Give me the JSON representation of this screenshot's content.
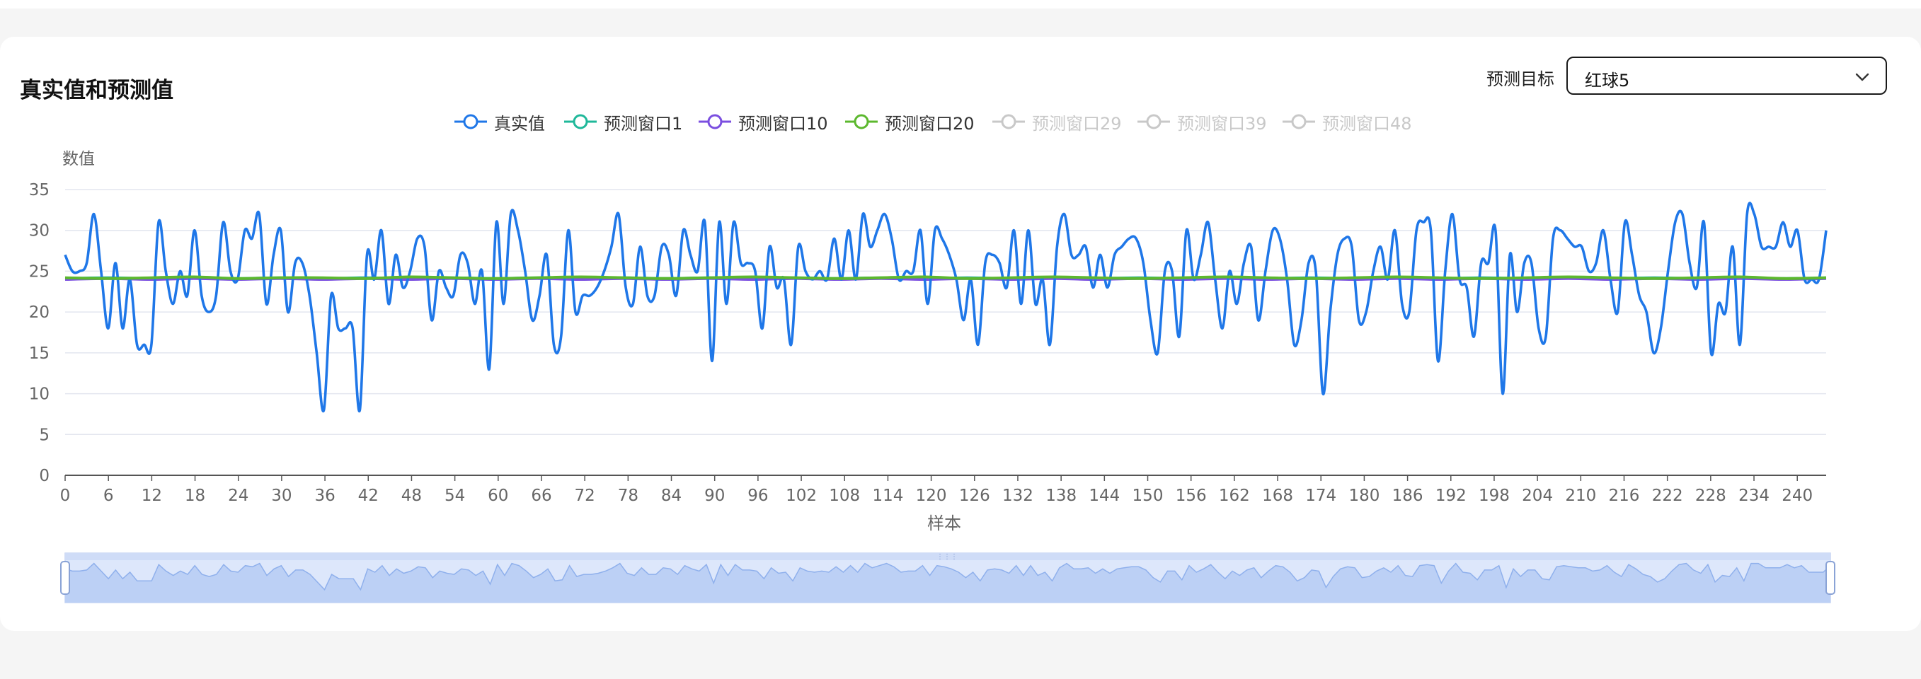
{
  "card": {
    "title": "真实值和预测值"
  },
  "target": {
    "label": "预测目标",
    "value": "红球5"
  },
  "legend": [
    {
      "name": "真实值",
      "color": "#1f77e8",
      "active": true
    },
    {
      "name": "预测窗口1",
      "color": "#1fb89a",
      "active": true
    },
    {
      "name": "预测窗口10",
      "color": "#7b4fe0",
      "active": true
    },
    {
      "name": "预测窗口20",
      "color": "#5cb82e",
      "active": true
    },
    {
      "name": "预测窗口29",
      "color": "#c8c8c8",
      "active": false
    },
    {
      "name": "预测窗口39",
      "color": "#c8c8c8",
      "active": false
    },
    {
      "name": "预测窗口48",
      "color": "#c8c8c8",
      "active": false
    }
  ],
  "chart_data": {
    "type": "line",
    "title": "",
    "xlabel": "样本",
    "ylabel": "数值",
    "ylim": [
      0,
      35
    ],
    "yticks": [
      0,
      5,
      10,
      15,
      20,
      25,
      30,
      35
    ],
    "xlim": [
      0,
      244
    ],
    "xticks": [
      0,
      6,
      12,
      18,
      24,
      30,
      36,
      42,
      48,
      54,
      60,
      66,
      72,
      78,
      84,
      90,
      96,
      102,
      108,
      114,
      120,
      126,
      132,
      138,
      144,
      150,
      156,
      162,
      168,
      174,
      180,
      186,
      192,
      198,
      204,
      210,
      216,
      222,
      228,
      234,
      240
    ],
    "grid": true,
    "legend_position": "top-center",
    "series": [
      {
        "name": "真实值",
        "color": "#1f77e8",
        "values": [
          27,
          25,
          25,
          26,
          32,
          25,
          18,
          26,
          18,
          24,
          16,
          16,
          16,
          31,
          25,
          21,
          25,
          22,
          30,
          22,
          20,
          22,
          31,
          25,
          24,
          30,
          29,
          32,
          21,
          27,
          30,
          20,
          26,
          26,
          22,
          15,
          8,
          22,
          18,
          18,
          18,
          8,
          27,
          24,
          30,
          21,
          27,
          23,
          25,
          29,
          28,
          19,
          25,
          23,
          22,
          27,
          26,
          21,
          25,
          13,
          31,
          21,
          32,
          30,
          25,
          19,
          22,
          27,
          16,
          17,
          30,
          20,
          22,
          22,
          23,
          25,
          28,
          32,
          23,
          21,
          28,
          22,
          22,
          28,
          27,
          22,
          30,
          27,
          25,
          31,
          14,
          31,
          21,
          31,
          26,
          26,
          25,
          18,
          28,
          23,
          24,
          16,
          28,
          25,
          24,
          25,
          24,
          29,
          24,
          30,
          24,
          32,
          28,
          30,
          32,
          29,
          24,
          25,
          25,
          30,
          21,
          30,
          29,
          27,
          24,
          19,
          24,
          16,
          26,
          27,
          26,
          23,
          30,
          21,
          30,
          21,
          24,
          16,
          28,
          32,
          27,
          27,
          28,
          23,
          27,
          23,
          27,
          28,
          29,
          29,
          26,
          19,
          15,
          25,
          25,
          17,
          30,
          24,
          27,
          31,
          24,
          18,
          25,
          21,
          26,
          28,
          19,
          25,
          30,
          29,
          24,
          16,
          19,
          26,
          25,
          10,
          20,
          27,
          29,
          28,
          19,
          20,
          25,
          28,
          24,
          30,
          21,
          20,
          30,
          31,
          30,
          14,
          25,
          32,
          24,
          23,
          17,
          26,
          26,
          30,
          10,
          27,
          20,
          26,
          26,
          18,
          17,
          29,
          30,
          29,
          28,
          28,
          25,
          26,
          30,
          24,
          20,
          31,
          27,
          22,
          20,
          15,
          18,
          25,
          31,
          32,
          26,
          23,
          31,
          15,
          21,
          20,
          28,
          16,
          32,
          32,
          28,
          28,
          28,
          31,
          28,
          30,
          24,
          24,
          24,
          30
        ]
      },
      {
        "name": "预测窗口1",
        "color": "#1fb89a",
        "values": [
          24.1,
          24.2,
          24.1,
          24.2,
          24.1,
          24.2,
          24.1,
          24.2,
          24.1,
          24.2,
          24.1,
          24.2,
          24.1,
          24.2,
          24.1,
          24.2,
          24.1,
          24.2,
          24.1,
          24.2,
          24.1,
          24.2,
          24.1,
          24.2,
          24.1,
          24.2,
          24.1,
          24.2,
          24.1,
          24.2,
          24.1,
          24.2,
          24.1,
          24.2,
          24.1,
          24.2,
          24.1,
          24.2,
          24.1,
          24.2,
          24.1,
          24.2
        ]
      },
      {
        "name": "预测窗口10",
        "color": "#7b4fe0",
        "values": [
          24.0,
          24.1,
          24.0,
          24.1,
          24.0,
          24.1,
          24.0,
          24.1,
          24.0,
          24.1,
          24.0,
          24.1,
          24.0,
          24.1,
          24.0,
          24.1,
          24.0,
          24.1,
          24.0,
          24.1,
          24.0,
          24.1,
          24.0,
          24.1,
          24.0,
          24.1,
          24.0,
          24.1,
          24.0,
          24.1,
          24.0,
          24.1,
          24.0,
          24.1,
          24.0,
          24.1,
          24.0,
          24.1,
          24.0,
          24.1,
          24.0,
          24.1
        ]
      },
      {
        "name": "预测窗口20",
        "color": "#5cb82e",
        "values": [
          24.2,
          24.1,
          24.2,
          24.3,
          24.1,
          24.2,
          24.2,
          24.1,
          24.3,
          24.2,
          24.1,
          24.2,
          24.3,
          24.2,
          24.1,
          24.2,
          24.3,
          24.2,
          24.1,
          24.2,
          24.3,
          24.1,
          24.2,
          24.3,
          24.2,
          24.1,
          24.2,
          24.3,
          24.2,
          24.1,
          24.2,
          24.3,
          24.2,
          24.1,
          24.2,
          24.3,
          24.2,
          24.1,
          24.2,
          24.3,
          24.1,
          24.2
        ]
      }
    ]
  }
}
